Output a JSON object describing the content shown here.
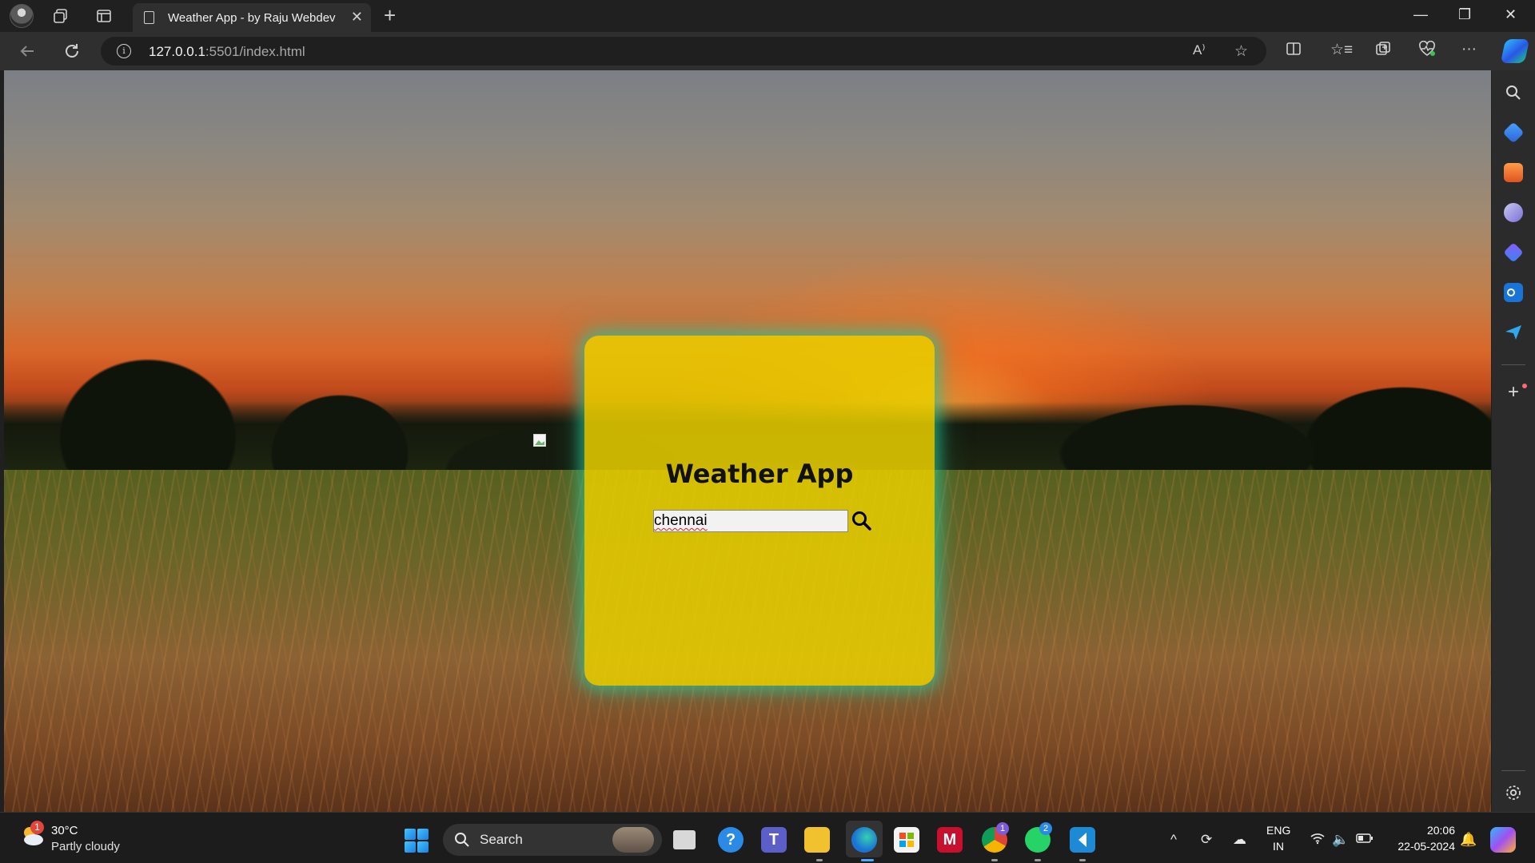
{
  "browser": {
    "tab_title": "Weather App - by Raju Webdev",
    "tab_close": "✕",
    "new_tab": "+",
    "url_host": "127.0.0.1",
    "url_path": ":5501/index.html",
    "read_aloud": "A⁾",
    "window": {
      "minimize": "—",
      "restore": "❐",
      "close": "✕"
    }
  },
  "page": {
    "card_title": "Weather App",
    "search_value": "chennai",
    "accent_card": "#E8CE00",
    "accent_glow": "#28C896"
  },
  "taskbar": {
    "weather_temp": "30°C",
    "weather_desc": "Partly cloudy",
    "weather_badge": "1",
    "search_label": "Search",
    "chrome_badge": "1",
    "whatsapp_badge": "2",
    "lang": "ENG",
    "region": "IN",
    "time": "20:06",
    "date": "22-05-2024"
  }
}
